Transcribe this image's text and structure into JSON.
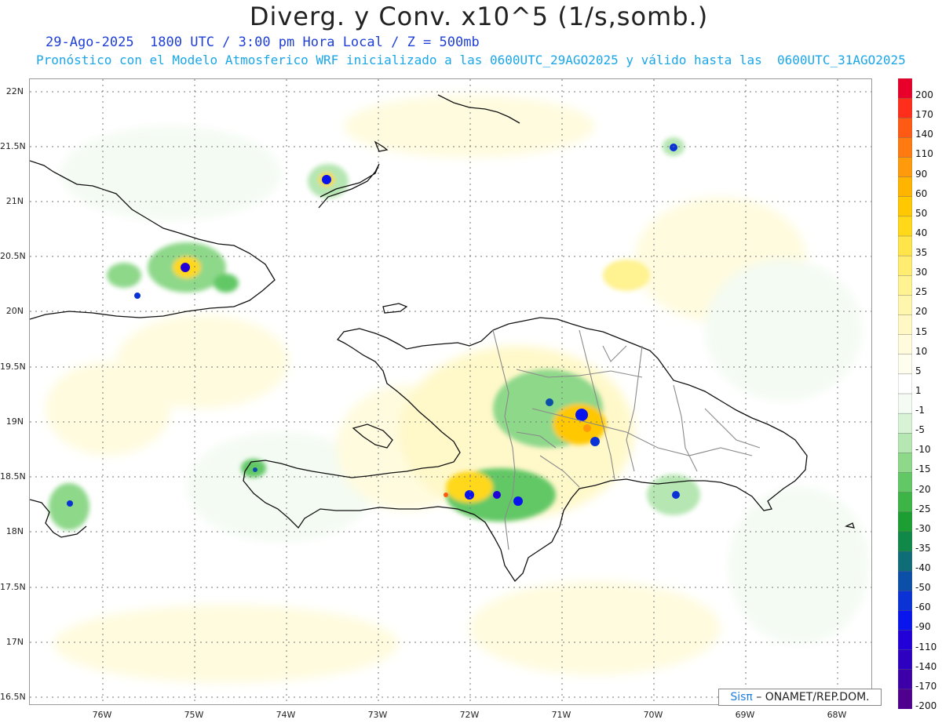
{
  "title": "Diverg. y Conv. x10^5 (1/s,somb.)",
  "subtitle_time": "29-Ago-2025  1800 UTC / 3:00 pm Hora Local / Z = 500mb",
  "subtitle_model": "Pronóstico con el Modelo Atmosferico WRF inicializado a las 0600UTC_29AGO2025 y válido hasta las  0600UTC_31AGO2025",
  "lat_labels": [
    "22N",
    "21.5N",
    "21N",
    "20.5N",
    "20N",
    "19.5N",
    "19N",
    "18.5N",
    "18N",
    "17.5N",
    "17N",
    "16.5N"
  ],
  "lon_labels": [
    "76W",
    "75W",
    "74W",
    "73W",
    "72W",
    "71W",
    "70W",
    "69W",
    "68W"
  ],
  "colorbar": {
    "labels": [
      "200",
      "170",
      "140",
      "110",
      "90",
      "60",
      "50",
      "40",
      "35",
      "30",
      "25",
      "20",
      "15",
      "10",
      "5",
      "1",
      "-1",
      "-5",
      "-10",
      "-15",
      "-20",
      "-25",
      "-30",
      "-35",
      "-40",
      "-50",
      "-60",
      "-90",
      "-110",
      "-140",
      "-170",
      "-200"
    ],
    "colors": [
      "#e8002a",
      "#ff2e1a",
      "#ff5a14",
      "#ff7a10",
      "#ff9a0a",
      "#ffb400",
      "#ffc800",
      "#ffd81a",
      "#ffe44a",
      "#ffec70",
      "#fff290",
      "#fff6ae",
      "#fff8c4",
      "#fffbdc",
      "#fffdee",
      "#ffffff",
      "#f3fbf2",
      "#d8f2d6",
      "#b6e6b2",
      "#8ed88a",
      "#62c866",
      "#3db446",
      "#1c9e32",
      "#0f8848",
      "#0f6d78",
      "#0c4fa8",
      "#0a32d4",
      "#0a14ec",
      "#2200d8",
      "#2e00c0",
      "#3d00a8",
      "#50008e"
    ]
  },
  "credit": {
    "logo": "Sisπ",
    "text": " – ONAMET/REP.DOM."
  },
  "colors": {
    "coast": "#111111",
    "province_borders": "#8a8a8a",
    "grid": "#777777"
  }
}
